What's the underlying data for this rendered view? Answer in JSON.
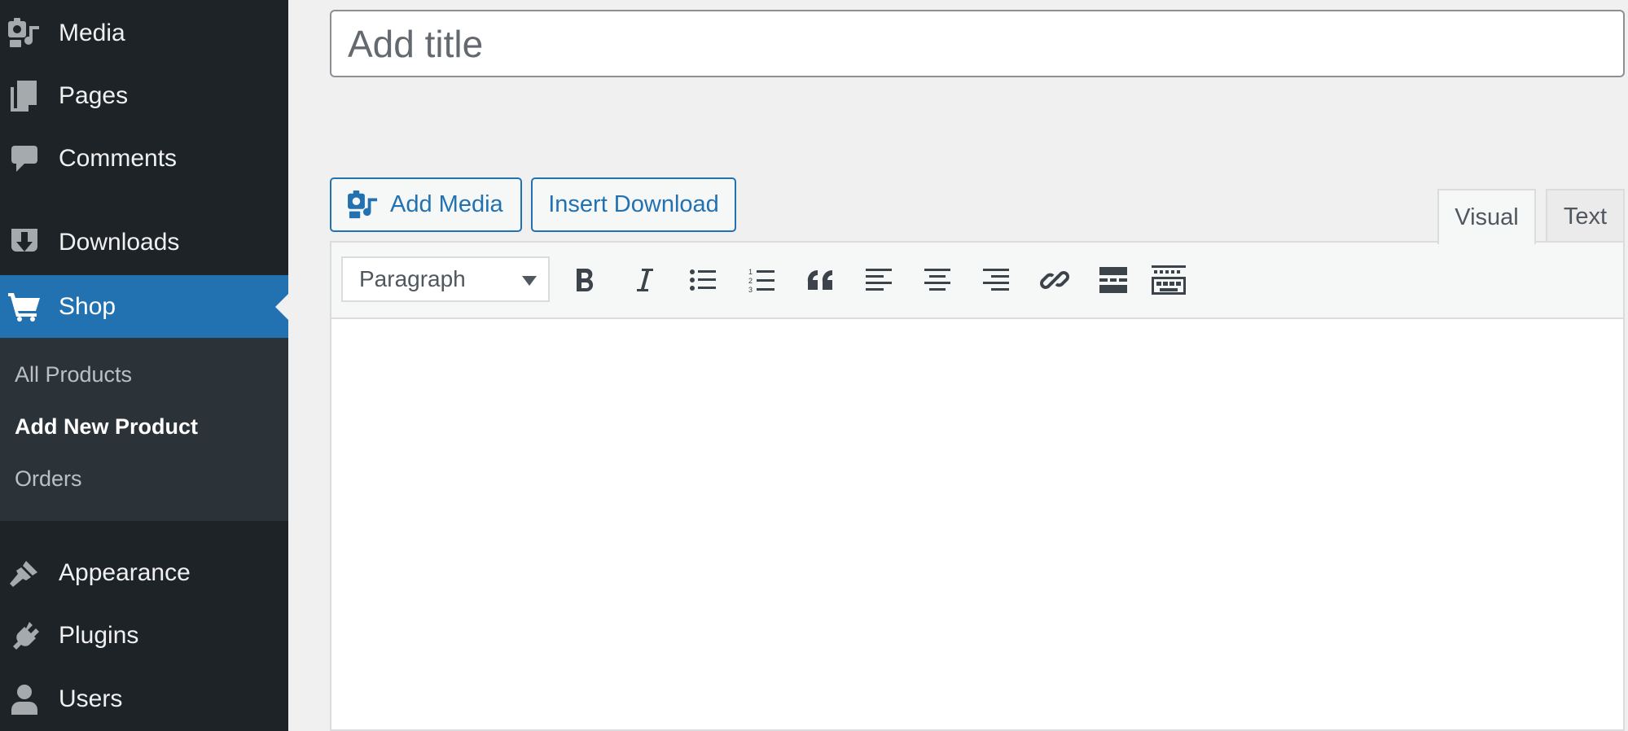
{
  "sidebar": {
    "items": [
      {
        "label": "Media",
        "icon": "media-icon"
      },
      {
        "label": "Pages",
        "icon": "pages-icon"
      },
      {
        "label": "Comments",
        "icon": "comments-icon"
      },
      {
        "label": "Downloads",
        "icon": "downloads-icon"
      },
      {
        "label": "Shop",
        "icon": "cart-icon",
        "active": true
      },
      {
        "label": "Appearance",
        "icon": "brush-icon"
      },
      {
        "label": "Plugins",
        "icon": "plug-icon"
      },
      {
        "label": "Users",
        "icon": "user-icon"
      }
    ],
    "submenu": [
      {
        "label": "All Products"
      },
      {
        "label": "Add New Product",
        "current": true
      },
      {
        "label": "Orders"
      }
    ]
  },
  "editor": {
    "title_placeholder": "Add title",
    "add_media_label": "Add Media",
    "insert_download_label": "Insert Download",
    "tabs": [
      {
        "label": "Visual",
        "active": true
      },
      {
        "label": "Text"
      }
    ],
    "format_select": "Paragraph",
    "toolbar_icons": [
      "bold-icon",
      "italic-icon",
      "bullet-list-icon",
      "numbered-list-icon",
      "blockquote-icon",
      "align-left-icon",
      "align-center-icon",
      "align-right-icon",
      "link-icon",
      "read-more-icon",
      "toolbar-toggle-icon"
    ]
  },
  "colors": {
    "sidebar_bg": "#1d2327",
    "submenu_bg": "#2c3338",
    "accent": "#2271b1",
    "page_bg": "#f0f0f1"
  }
}
